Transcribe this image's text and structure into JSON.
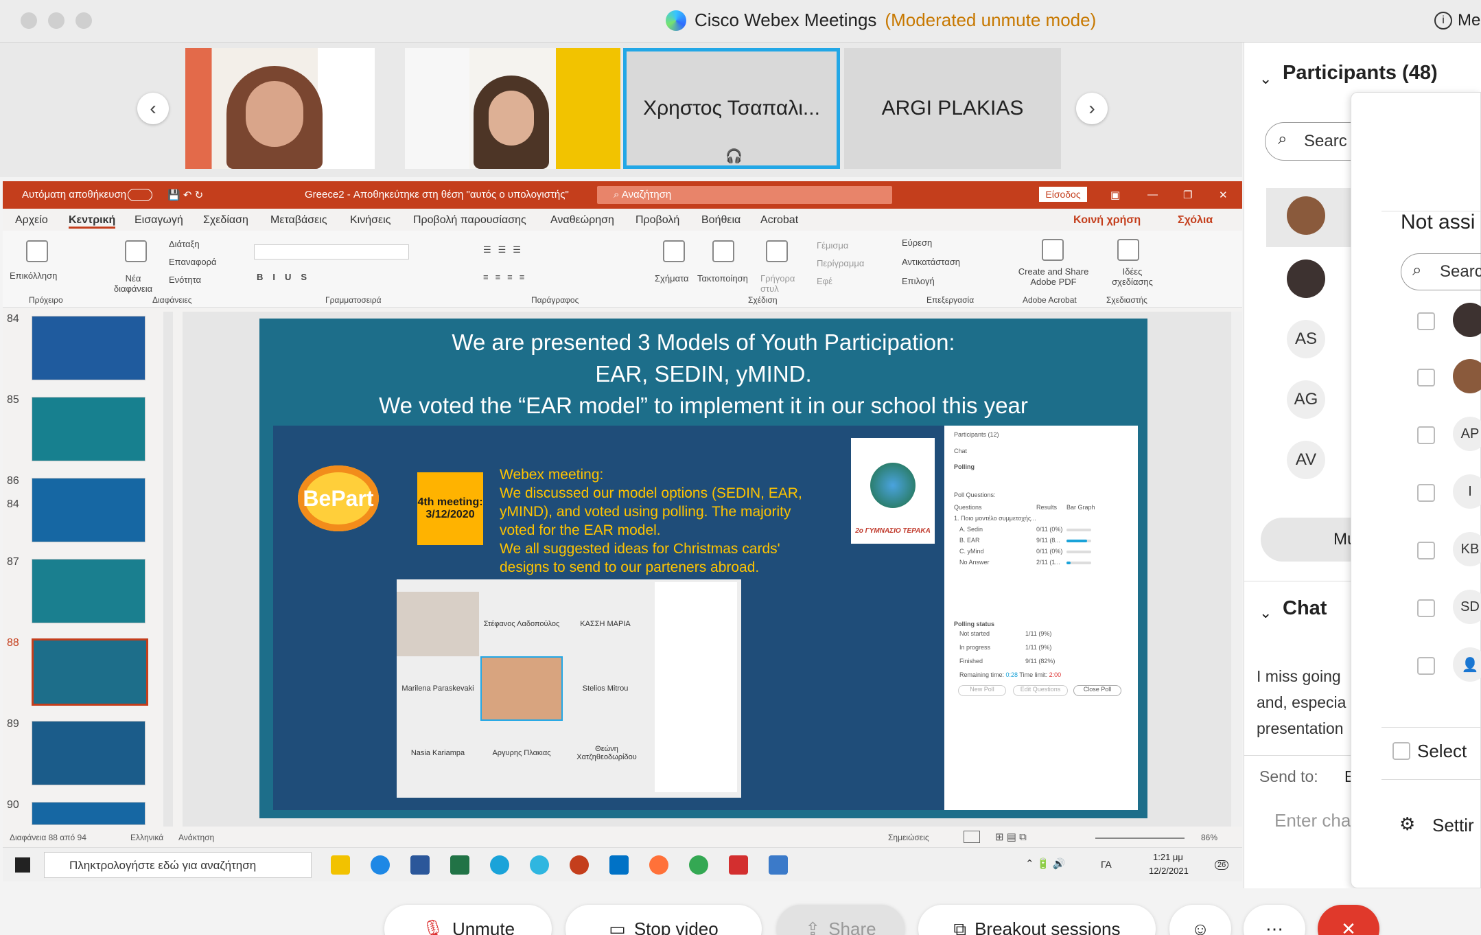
{
  "window": {
    "app_title": "Cisco Webex Meetings",
    "mode": "(Moderated unmute mode)",
    "meeting_info_label": "Me"
  },
  "video_strip": {
    "tiles": [
      {
        "name": "",
        "kind": "video"
      },
      {
        "name": "",
        "kind": "video"
      },
      {
        "name": "Χρηστος Τσαπαλι...",
        "kind": "name",
        "active": true
      },
      {
        "name": "ARGI PLAKIAS",
        "kind": "name"
      }
    ]
  },
  "ppt": {
    "autosave": "Αυτόματη αποθήκευση",
    "doc_title": "Greece2 - Αποθηκεύτηκε στη θέση \"αυτός ο υπολογιστής\"",
    "search_placeholder": "Αναζήτηση",
    "signin": "Είσοδος",
    "menu": [
      "Αρχείο",
      "Κεντρική",
      "Εισαγωγή",
      "Σχεδίαση",
      "Μεταβάσεις",
      "Κινήσεις",
      "Προβολή παρουσίασης",
      "Αναθεώρηση",
      "Προβολή",
      "Βοήθεια",
      "Acrobat"
    ],
    "share_label": "Κοινή χρήση",
    "comments_label": "Σχόλια",
    "ribbon_groups": [
      "Πρόχειρο",
      "Διαφάνειες",
      "Γραμματοσειρά",
      "Παράγραφος",
      "Σχέδιση",
      "Επεξεργασία",
      "Adobe Acrobat",
      "Σχεδιαστής"
    ],
    "ribbon_labels": {
      "paste": "Επικόλληση",
      "new_slide": "Νέα διαφάνεια",
      "layout": "Διάταξη",
      "reset": "Επαναφορά",
      "section": "Ενότητα",
      "shapes": "Σχήματα",
      "arrange": "Τακτοποίηση",
      "quick_styles": "Γρήγορα στυλ",
      "find": "Εύρεση",
      "replace": "Αντικατάσταση",
      "select": "Επιλογή",
      "create_pdf": "Create and Share Adobe PDF",
      "design_ideas": "Ιδέες σχεδίασης",
      "fill": "Γέμισμα",
      "outline": "Περίγραμμα",
      "effects": "Εφέ"
    },
    "thumbnails": [
      "84",
      "85",
      "86",
      "87",
      "88",
      "89",
      "90"
    ],
    "selected_thumbnail": "88",
    "slide": {
      "heading_lines": [
        "We are presented 3 Models of Youth Participation:",
        "EAR, SEDIN, yMIND.",
        "We voted the “EAR model” to implement it in our school this year"
      ],
      "logo_text": "BePart",
      "meeting_badge": "4th meeting: 3/12/2020",
      "body_lines": [
        "Webex meeting:",
        "We discussed our model options (SEDIN, EAR,",
        "yMIND), and voted using polling. The majority",
        "voted for the EAR model.",
        "We all suggested ideas for Christmas cards'",
        "designs to send to our parteners abroad."
      ],
      "school_label": "2ο ΓΥΜΝΑΣΙΟ ΤΕΡΑΚΑ",
      "mini_names": [
        "Στέφανος Λαδοπούλος",
        "ΚΑΣΣΗ ΜΑΡΙΑ",
        "Marilena Paraskevaki",
        "Stelios Mitrou",
        "Nasia Kariampa",
        "Αργυρης Πλακιας",
        "Θεώνη Χατζηθεοδωρίδου"
      ],
      "poll": {
        "participants": "Participants (12)",
        "chat": "Chat",
        "polling": "Polling",
        "poll_questions": "Poll Questions:",
        "col_questions": "Questions",
        "col_results": "Results",
        "col_bar": "Bar Graph",
        "question": "1. Ποιο μοντέλο συμμετοχής...",
        "options": [
          {
            "label": "A. Sedin",
            "result": "0/11 (0%)",
            "pct": 0
          },
          {
            "label": "B. EAR",
            "result": "9/11 (8...",
            "pct": 82
          },
          {
            "label": "C. yMind",
            "result": "0/11 (0%)",
            "pct": 0
          },
          {
            "label": "No Answer",
            "result": "2/11 (1...",
            "pct": 18
          }
        ],
        "status_title": "Polling status",
        "status": [
          {
            "label": "Not started",
            "value": "1/11 (9%)"
          },
          {
            "label": "In progress",
            "value": "1/11 (9%)"
          },
          {
            "label": "Finished",
            "value": "9/11 (82%)"
          }
        ],
        "remaining_label": "Remaining time:",
        "remaining": "0:28",
        "limit_label": "Time limit:",
        "limit": "2:00",
        "buttons": [
          "New Poll",
          "Edit Questions",
          "Close Poll"
        ]
      }
    },
    "status_left": "Διαφάνεια 88 από 94",
    "status_lang": "Ελληνικά",
    "status_access": "Ανάκτηση",
    "status_notes": "Σημειώσεις",
    "zoom": "86%",
    "taskbar_search": "Πληκτρολογήστε εδώ για αναζήτηση",
    "taskbar_lang": "ΓΑ",
    "clock_time": "1:21 μμ",
    "clock_date": "12/2/2021",
    "notif_count": "26"
  },
  "participants_panel": {
    "title": "Participants (48)",
    "search_placeholder": "Searc",
    "items": [
      {
        "initials": "",
        "photo": true
      },
      {
        "initials": "",
        "photo": true
      },
      {
        "initials": "AS"
      },
      {
        "initials": "AG"
      },
      {
        "initials": "AV"
      }
    ],
    "mute_all_partial": "Mu",
    "chat_title": "Chat",
    "chat_lines": [
      "I miss going",
      "and, especia",
      "presentation"
    ],
    "send_to_label": "Send to:",
    "send_to_value": "E",
    "chat_placeholder": "Enter cha"
  },
  "assign_popup": {
    "title": "Not assi",
    "search_placeholder": "Searc",
    "rows": [
      "",
      "",
      "AP",
      "I",
      "KB",
      "SD",
      "person"
    ],
    "select_all": "Select",
    "settings": "Settir"
  },
  "controls": {
    "unmute": "Unmute",
    "stop_video": "Stop video",
    "share": "Share",
    "breakout": "Breakout sessions"
  }
}
